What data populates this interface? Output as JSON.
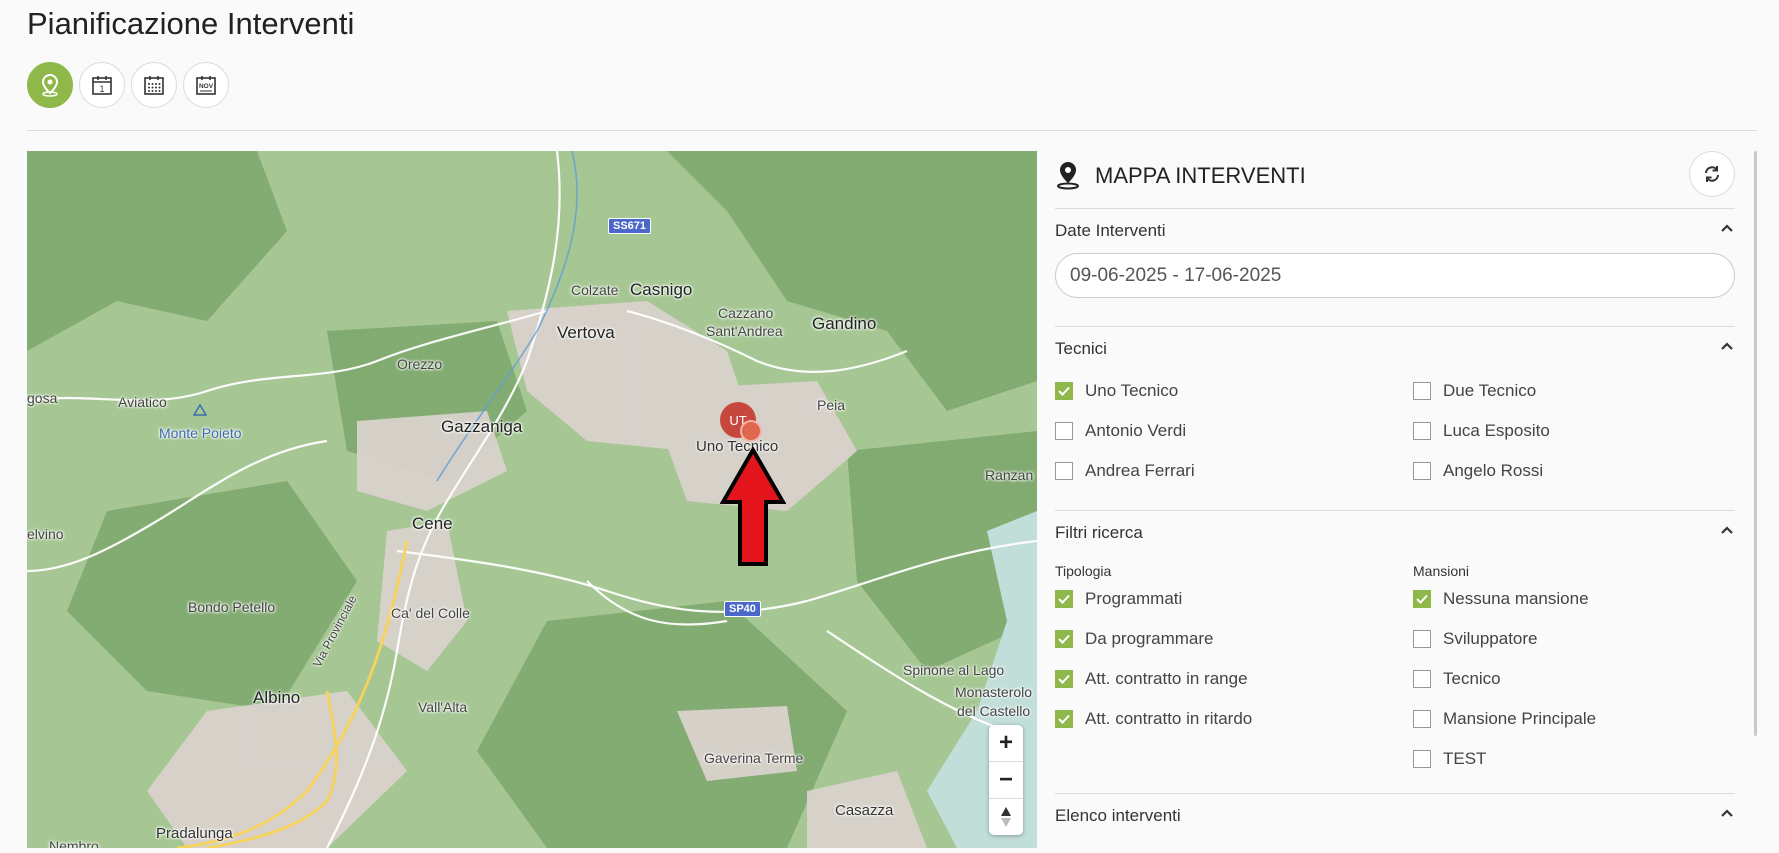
{
  "page": {
    "title": "Pianificazione Interventi"
  },
  "view_buttons": [
    {
      "name": "map",
      "icon": "map-pin-icon",
      "active": true
    },
    {
      "name": "day",
      "icon": "calendar-day-icon",
      "label": "1",
      "active": false
    },
    {
      "name": "week",
      "icon": "calendar-grid-icon",
      "active": false
    },
    {
      "name": "month",
      "icon": "calendar-month-icon",
      "label": "NOV",
      "active": false
    }
  ],
  "map": {
    "places": {
      "colzate": "Colzate",
      "casnigo": "Casnigo",
      "cazzano": "Cazzano",
      "cazzano2": "Sant'Andrea",
      "gandino": "Gandino",
      "vertova": "Vertova",
      "orezzo": "Orezzo",
      "aviatico": "Aviatico",
      "gosa": "gosa",
      "peia": "Peia",
      "gazzaniga": "Gazzaniga",
      "monte_poieto": "Monte Poieto",
      "cene": "Cene",
      "ranzan": "Ranzan",
      "elvino": "elvino",
      "bondo": "Bondo Petello",
      "cadelcolle": "Ca' del Colle",
      "via_provinciale": "Via Provinciale",
      "spinone": "Spinone al Lago",
      "albino": "Albino",
      "vallalta": "Vall'Alta",
      "monasterolo": "Monasterolo",
      "castello": "del Castello",
      "gaverina": "Gaverina Terme",
      "casazza": "Casazza",
      "pradalunga": "Pradalunga",
      "nembro": "Nembro"
    },
    "road_signs": {
      "ss671": "SS671",
      "sp40": "SP40"
    },
    "marker": {
      "initials": "UT",
      "label": "Uno Tecnico"
    },
    "zoom": {
      "in": "+",
      "out": "−",
      "north": "▲"
    }
  },
  "panel": {
    "title": "MAPPA INTERVENTI",
    "sections": {
      "date": {
        "title": "Date Interventi",
        "value": "09-06-2025 - 17-06-2025"
      },
      "tecnici": {
        "title": "Tecnici",
        "left": [
          {
            "label": "Uno Tecnico",
            "checked": true
          },
          {
            "label": "Antonio Verdi",
            "checked": false
          },
          {
            "label": "Andrea Ferrari",
            "checked": false
          }
        ],
        "right": [
          {
            "label": "Due Tecnico",
            "checked": false
          },
          {
            "label": "Luca Esposito",
            "checked": false
          },
          {
            "label": "Angelo Rossi",
            "checked": false
          }
        ]
      },
      "filtri": {
        "title": "Filtri ricerca",
        "tipologia_label": "Tipologia",
        "mansioni_label": "Mansioni",
        "tipologia": [
          {
            "label": "Programmati",
            "checked": true
          },
          {
            "label": "Da programmare",
            "checked": true
          },
          {
            "label": "Att. contratto in range",
            "checked": true
          },
          {
            "label": "Att. contratto in ritardo",
            "checked": true
          }
        ],
        "mansioni": [
          {
            "label": "Nessuna mansione",
            "checked": true
          },
          {
            "label": "Sviluppatore",
            "checked": false
          },
          {
            "label": "Tecnico",
            "checked": false
          },
          {
            "label": "Mansione Principale",
            "checked": false
          },
          {
            "label": "TEST",
            "checked": false
          }
        ]
      },
      "elenco": {
        "title": "Elenco interventi"
      }
    }
  },
  "colors": {
    "accent": "#8fb84a",
    "marker": "#c8473d",
    "arrow": "#e3141b"
  }
}
